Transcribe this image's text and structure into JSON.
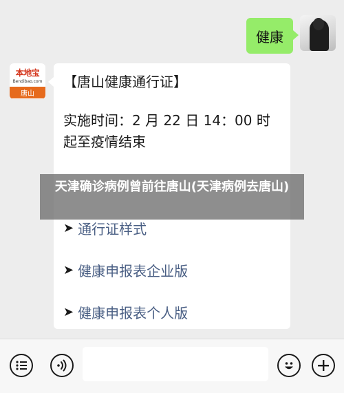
{
  "sent_message": {
    "text": "健康"
  },
  "bot_avatar": {
    "brand": "本地宝",
    "site": "Bendibao.com",
    "city": "唐山"
  },
  "received_message": {
    "title": "【唐山健康通行证】",
    "time_text": "实施时间：2 月 22 日 14：00 时起至疫情结束",
    "links": [
      {
        "arrow": "➤",
        "label": "通行证样式"
      },
      {
        "arrow": "➤",
        "label": "健康申报表企业版"
      },
      {
        "arrow": "➤",
        "label": "健康申报表个人版"
      }
    ]
  },
  "watermark": {
    "text": "天津确诊病例曾前往唐山(天津病例去唐山)"
  },
  "input_bar": {
    "icons": [
      "menu-icon",
      "voice-icon",
      "emoji-icon",
      "plus-icon"
    ],
    "input_value": ""
  },
  "colors": {
    "sent_bubble": "#95ec69",
    "link": "#4a5f84",
    "background": "#ededed"
  }
}
